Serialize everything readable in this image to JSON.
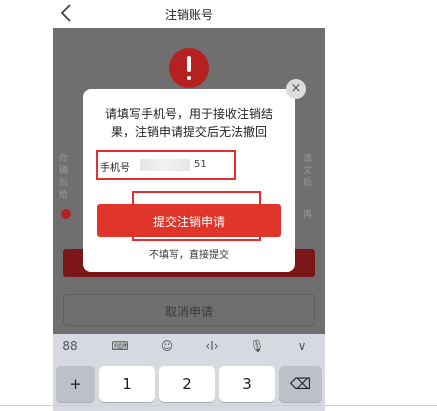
{
  "header": {
    "title": "注销账号"
  },
  "background": {
    "left_chars": [
      "你",
      "确",
      "后",
      "给"
    ],
    "right_chars": [
      "请",
      "文",
      "后",
      "再"
    ],
    "cancel_label": "取消申请"
  },
  "dialog": {
    "message_line1": "请填写手机号，用于接收注销结",
    "message_line2": "果，注销申请提交后无法撤回",
    "phone_label": "手机号",
    "phone_visible_tail": "51",
    "submit_label": "提交注销申请",
    "skip_label": "不填写，直接提交",
    "close_symbol": "×"
  },
  "keyboard": {
    "tool_icons": [
      "grid-icon",
      "keyboard-icon",
      "emoji-icon",
      "cursor-icon",
      "microphone-icon",
      "chevron-down-icon"
    ],
    "tool_glyphs": [
      "88",
      "⌨",
      "☺",
      "‹I›",
      "🎙",
      "∨"
    ],
    "keys": [
      "+",
      "1",
      "2",
      "3",
      "⌫"
    ]
  },
  "colors": {
    "accent_red": "#e0352b",
    "annotation_red": "#e23030",
    "overlay_gray": "#6f6f6f"
  }
}
